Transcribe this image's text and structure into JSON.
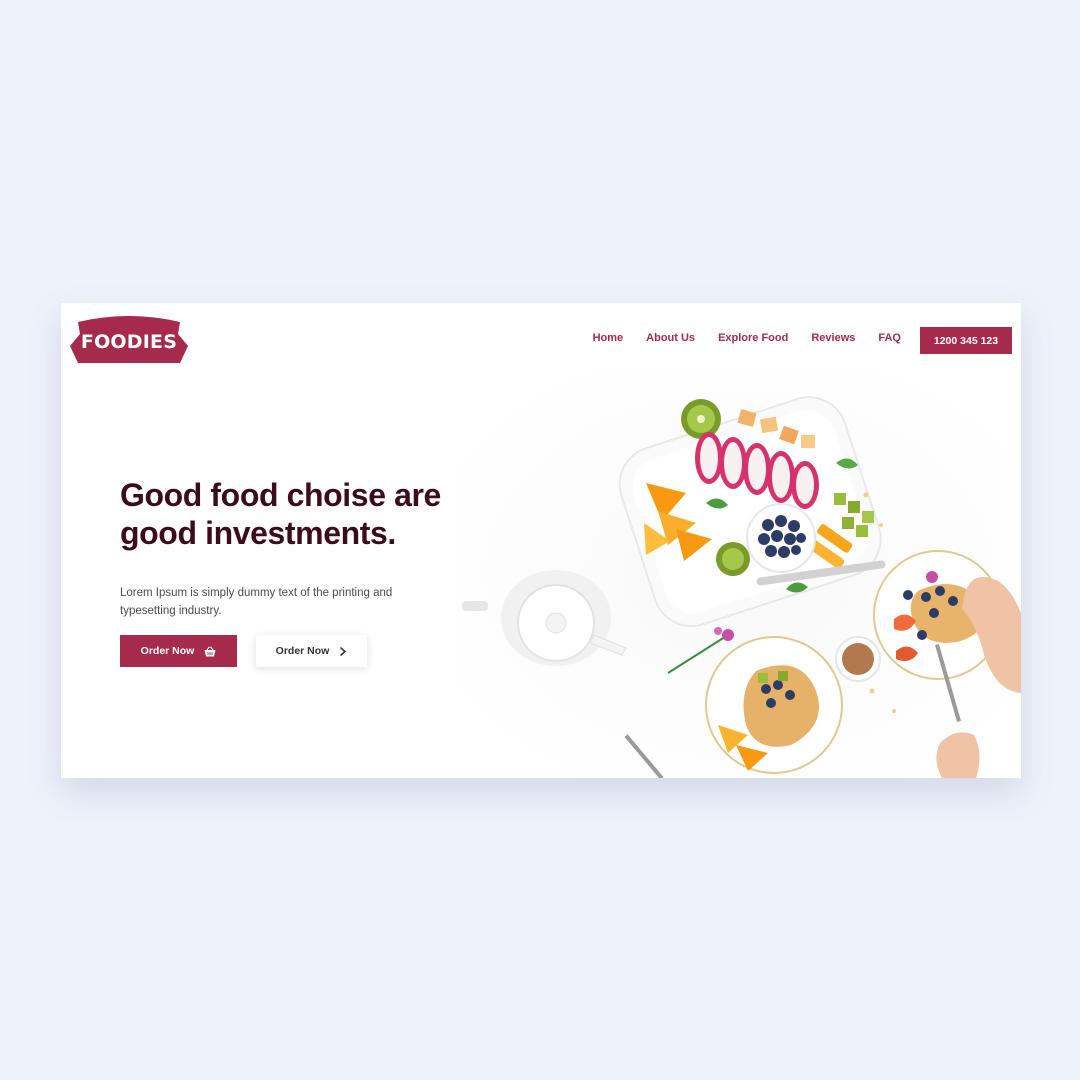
{
  "brand": {
    "name": "FOODIES",
    "color": "#a52a4b"
  },
  "nav": {
    "items": [
      {
        "label": "Home"
      },
      {
        "label": "About Us"
      },
      {
        "label": "Explore Food"
      },
      {
        "label": "Reviews"
      },
      {
        "label": "FAQ"
      }
    ],
    "phone_label": "1200 345 123"
  },
  "hero": {
    "title_line1": "Good food choise are",
    "title_line2": "good investments.",
    "description_line1": "Lorem Ipsum is simply dummy text of the printing and",
    "description_line2": "typesetting industry.",
    "primary_button": {
      "label": "Order Now",
      "icon": "basket-icon"
    },
    "secondary_button": {
      "label": "Order Now",
      "icon": "chevron-right-icon"
    }
  },
  "colors": {
    "accent": "#a52a4b",
    "heading": "#3d0c1c",
    "page_bg": "#eef2fa"
  }
}
